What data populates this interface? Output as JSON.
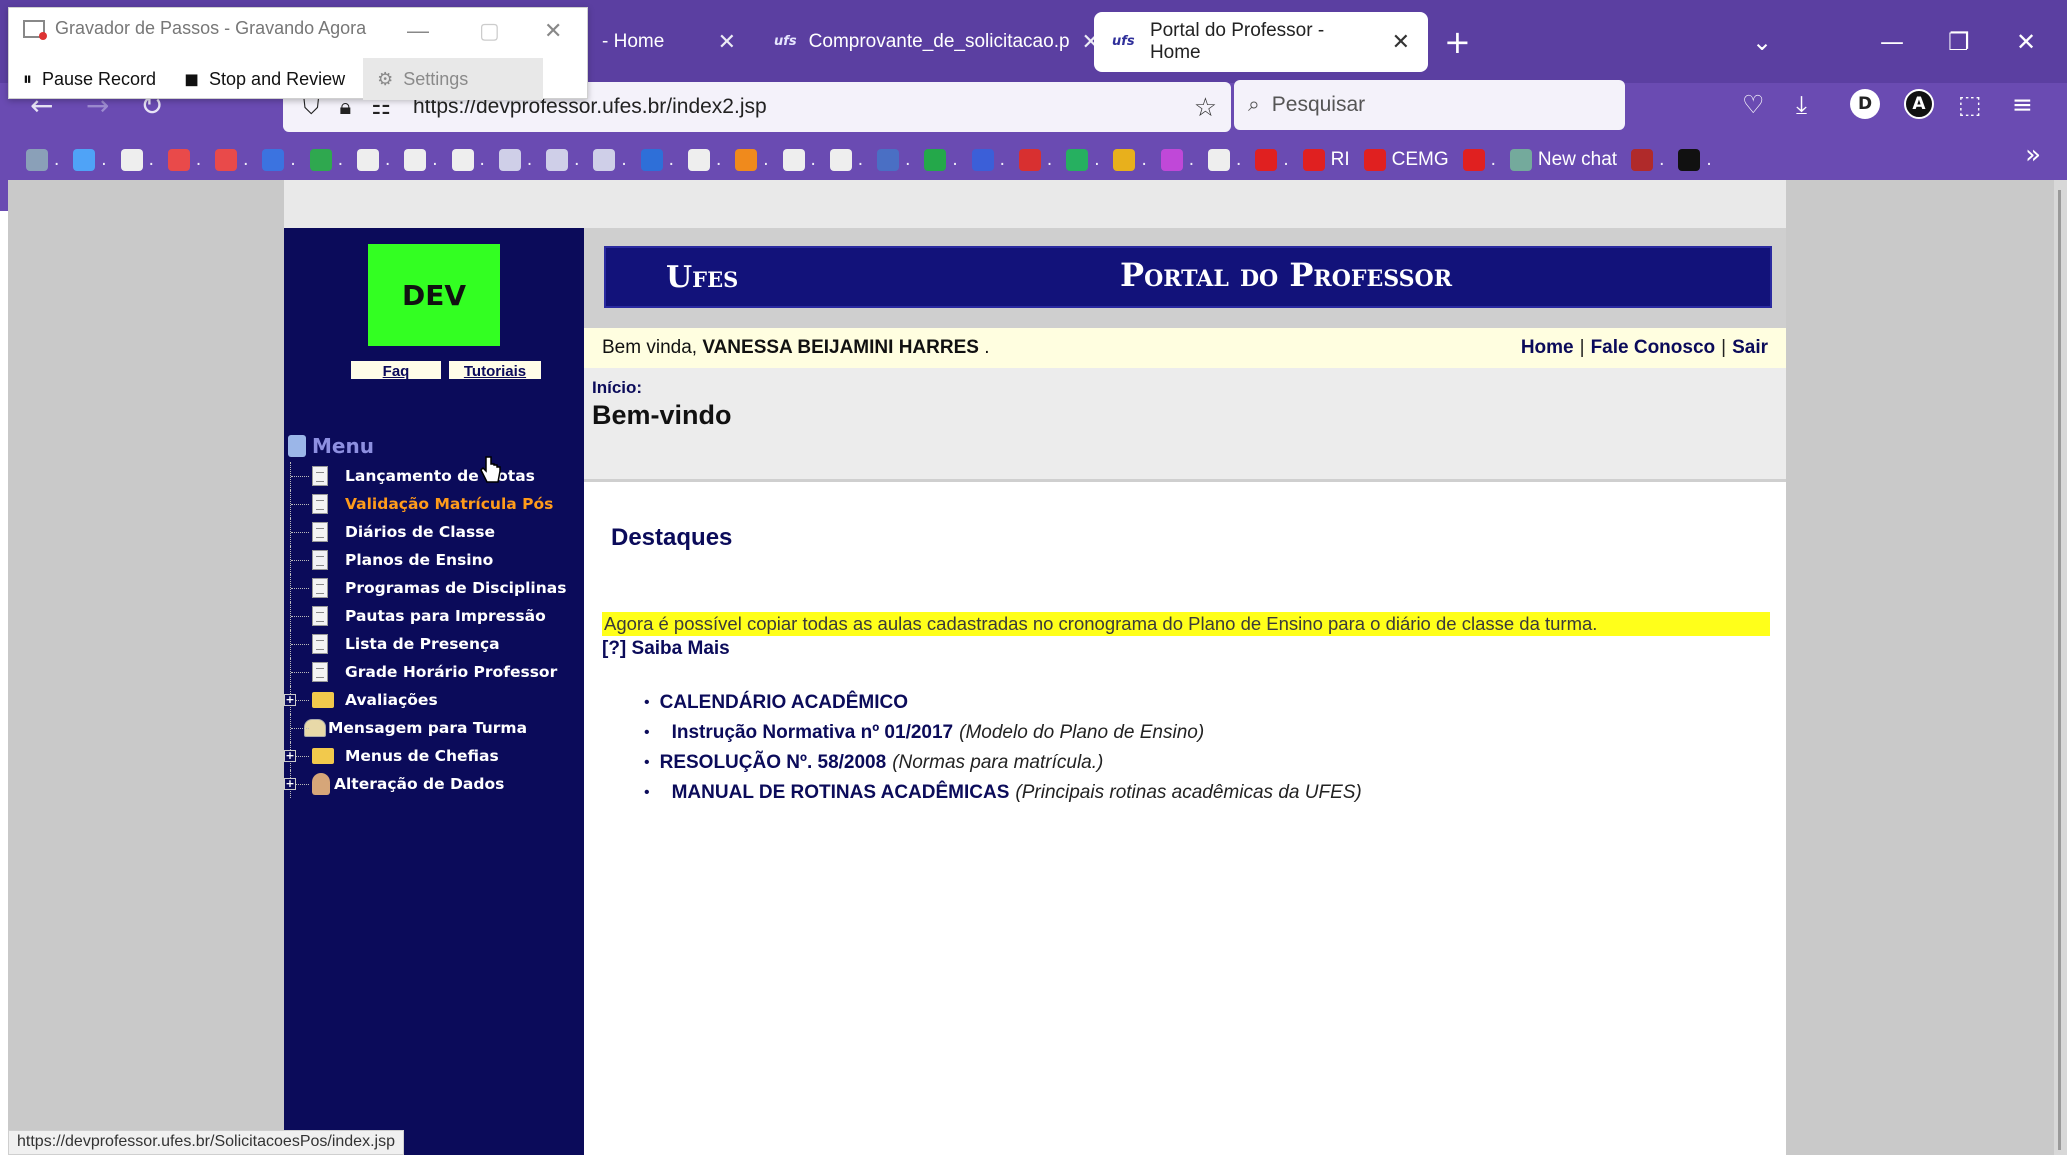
{
  "browser": {
    "tabs": [
      {
        "label": "- Home",
        "favicon": "globe"
      },
      {
        "label": "Comprovante_de_solicitacao.p",
        "favicon": "ufes"
      },
      {
        "label": "Portal do Professor - Home",
        "favicon": "ufes",
        "active": true
      }
    ],
    "url": "https://devprofessor.ufes.br/index2.jsp",
    "search_placeholder": "Pesquisar",
    "bookmarks": [
      {
        "label": "",
        "color": "#8aa0b8"
      },
      {
        "label": "",
        "color": "#4fa3f7"
      },
      {
        "label": "",
        "color": "#eeeeee"
      },
      {
        "label": "",
        "color": "#e94a4a"
      },
      {
        "label": "",
        "color": "#e94a4a"
      },
      {
        "label": "",
        "color": "#3b73e0"
      },
      {
        "label": "",
        "color": "#2fa84f"
      },
      {
        "label": "",
        "color": "#eeeeee"
      },
      {
        "label": "",
        "color": "#eeeeee"
      },
      {
        "label": "",
        "color": "#eeeeee"
      },
      {
        "label": "",
        "color": "#cfcfe8"
      },
      {
        "label": "",
        "color": "#cfcfe8"
      },
      {
        "label": "",
        "color": "#cfcfe8"
      },
      {
        "label": "",
        "color": "#2e6fd8"
      },
      {
        "label": "",
        "color": "#eeeeee"
      },
      {
        "label": "",
        "color": "#f08a1c"
      },
      {
        "label": "",
        "color": "#eeeeee"
      },
      {
        "label": "",
        "color": "#eeeeee"
      },
      {
        "label": "",
        "color": "#4a6fc4"
      },
      {
        "label": "",
        "color": "#24a84a"
      },
      {
        "label": "",
        "color": "#3b5fd8"
      },
      {
        "label": "",
        "color": "#d83030"
      },
      {
        "label": "",
        "color": "#26b060"
      },
      {
        "label": "",
        "color": "#e8b01c"
      },
      {
        "label": "",
        "color": "#c048d8"
      },
      {
        "label": "",
        "color": "#eeeeee"
      },
      {
        "label": "",
        "color": "#e02020"
      },
      {
        "label": "RI",
        "color": "#e02020"
      },
      {
        "label": "CEMG",
        "color": "#e02020"
      },
      {
        "label": "",
        "color": "#e02020"
      },
      {
        "label": "New chat",
        "color": "#74aa9c"
      },
      {
        "label": "",
        "color": "#b02a2a"
      },
      {
        "label": "",
        "color": "#111111"
      }
    ]
  },
  "recorder": {
    "title": "Gravador de Passos - Gravando Agora",
    "pause": "Pause Record",
    "stop": "Stop and Review",
    "settings": "Settings"
  },
  "sidebar": {
    "logo": "DEV",
    "faq": "Faq",
    "tutorials": "Tutoriais",
    "menu_title": "Menu",
    "items": [
      {
        "label": "Lançamento de Notas",
        "icon": "doc"
      },
      {
        "label": "Validação Matrícula Pós",
        "icon": "doc",
        "active": true
      },
      {
        "label": "Diários de Classe",
        "icon": "doc"
      },
      {
        "label": "Planos de Ensino",
        "icon": "doc"
      },
      {
        "label": "Programas de Disciplinas",
        "icon": "doc"
      },
      {
        "label": "Pautas para Impressão",
        "icon": "doc"
      },
      {
        "label": "Lista de Presença",
        "icon": "doc"
      },
      {
        "label": "Grade Horário Professor",
        "icon": "doc"
      },
      {
        "label": "Avaliações",
        "icon": "folder",
        "expandable": true
      },
      {
        "label": "Mensagem para Turma",
        "icon": "envelope"
      },
      {
        "label": "Menus de Chefias",
        "icon": "folder",
        "expandable": true
      },
      {
        "label": "Alteração de Dados",
        "icon": "user",
        "expandable": true
      }
    ]
  },
  "header": {
    "ufes": "Ufes",
    "portal": "Portal do Professor",
    "welcome_prefix": "Bem vinda,",
    "user_name": "VANESSA BEIJAMINI HARRES",
    "welcome_suffix": ".",
    "nav": [
      "Home",
      "Fale Conosco",
      "Sair"
    ]
  },
  "main": {
    "breadcrumb": "Início:",
    "title": "Bem-vindo",
    "section": "Destaques",
    "notice": "Agora é possível copiar todas as aulas cadastradas no cronograma do Plano de Ensino para o diário de classe da turma.",
    "saiba_mais": "[?] Saiba Mais",
    "links": [
      {
        "label": "CALENDÁRIO ACADÊMICO",
        "desc": "",
        "indent": false
      },
      {
        "label": "Instrução Normativa nº 01/2017",
        "desc": "(Modelo do Plano de Ensino)",
        "indent": true
      },
      {
        "label": "RESOLUÇÃO Nº. 58/2008",
        "desc": "(Normas para matrícula.)",
        "indent": false
      },
      {
        "label": "MANUAL DE ROTINAS ACADÊMICAS",
        "desc": "(Principais rotinas acadêmicas da UFES)",
        "indent": true
      }
    ]
  },
  "status_url": "https://devprofessor.ufes.br/SolicitacoesPos/index.jsp",
  "colors": {
    "chrome": "#5b3fa1",
    "sidebar": "#0b0b5a",
    "accent": "#ff9b1a",
    "notice": "#ffff1a"
  }
}
